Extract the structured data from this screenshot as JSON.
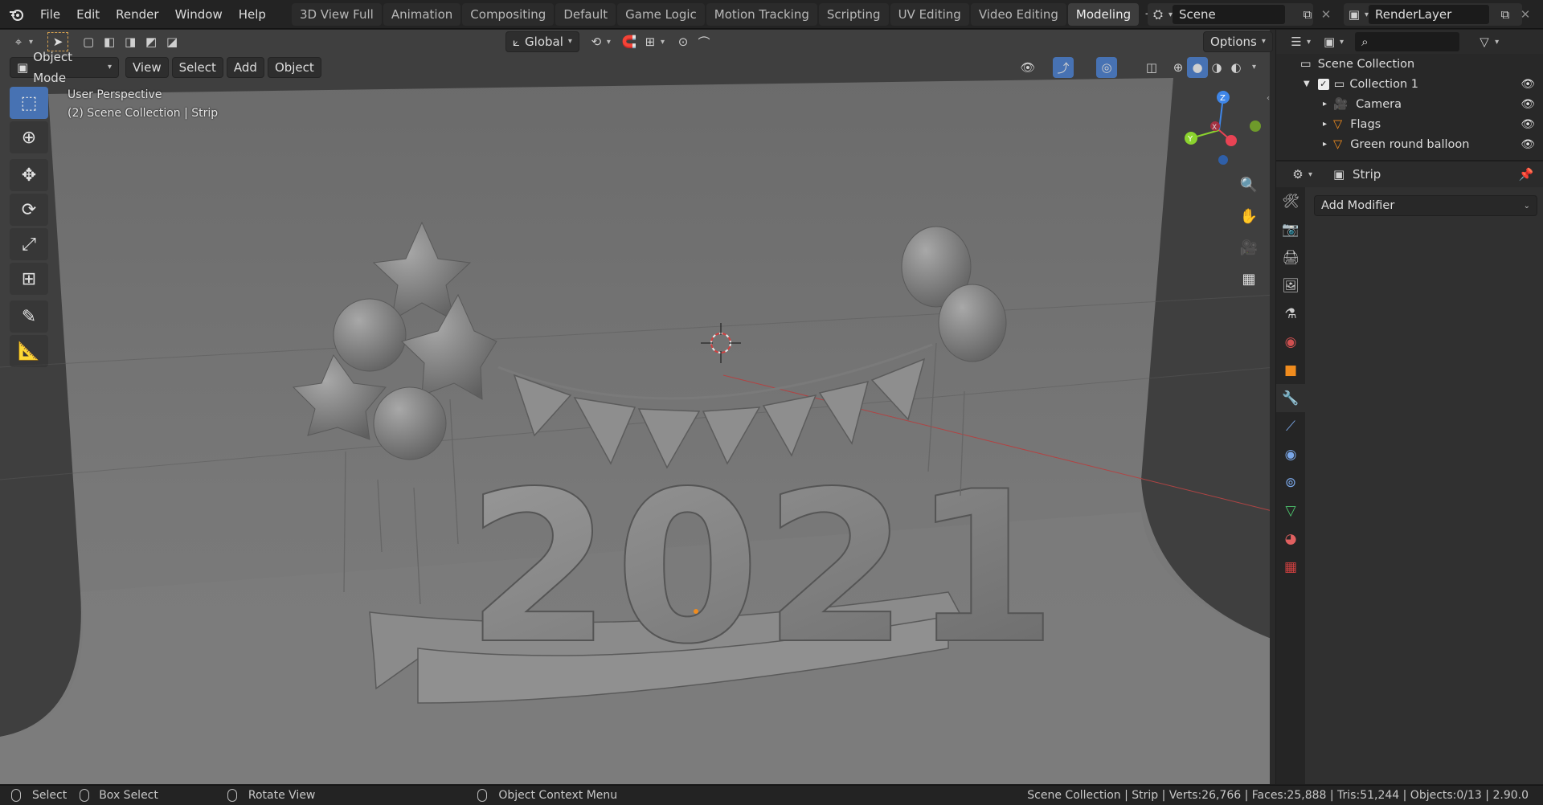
{
  "menu": [
    "File",
    "Edit",
    "Render",
    "Window",
    "Help"
  ],
  "workspaces": [
    {
      "label": "3D View Full",
      "active": false
    },
    {
      "label": "Animation",
      "active": false
    },
    {
      "label": "Compositing",
      "active": false
    },
    {
      "label": "Default",
      "active": false
    },
    {
      "label": "Game Logic",
      "active": false
    },
    {
      "label": "Motion Tracking",
      "active": false
    },
    {
      "label": "Scripting",
      "active": false
    },
    {
      "label": "UV Editing",
      "active": false
    },
    {
      "label": "Video Editing",
      "active": false
    },
    {
      "label": "Modeling",
      "active": true
    }
  ],
  "scene_name": "Scene",
  "view_layer_name": "RenderLayer",
  "header": {
    "transform_orientation": "Global",
    "options_label": "Options",
    "mode": "Object Mode",
    "view_menus": [
      "View",
      "Select",
      "Add",
      "Object"
    ]
  },
  "viewport": {
    "perspective_label": "User Perspective",
    "context_label": "(2) Scene Collection | Strip",
    "year_text": "2021",
    "gizmo_axes": {
      "z": "Z",
      "y": "Y",
      "x": "X"
    }
  },
  "outliner": {
    "root": "Scene Collection",
    "collection": "Collection 1",
    "items": [
      {
        "label": "Camera",
        "icon": "camera-icon"
      },
      {
        "label": "Flags",
        "icon": "mesh-icon"
      },
      {
        "label": "Green round balloon",
        "icon": "mesh-icon"
      }
    ]
  },
  "properties": {
    "object_name": "Strip",
    "add_modifier_label": "Add Modifier"
  },
  "statusbar": {
    "select": "Select",
    "box_select": "Box Select",
    "rotate_view": "Rotate View",
    "context_menu": "Object Context Menu",
    "stats": "Scene Collection | Strip | Verts:26,766 | Faces:25,888 | Tris:51,244 | Objects:0/13 | 2.90.0"
  },
  "colors": {
    "accent": "#4772b3",
    "active_tool": "#4772b3",
    "axis_x": "#e94354",
    "axis_y": "#8bd32e",
    "axis_z": "#3f86e8"
  }
}
